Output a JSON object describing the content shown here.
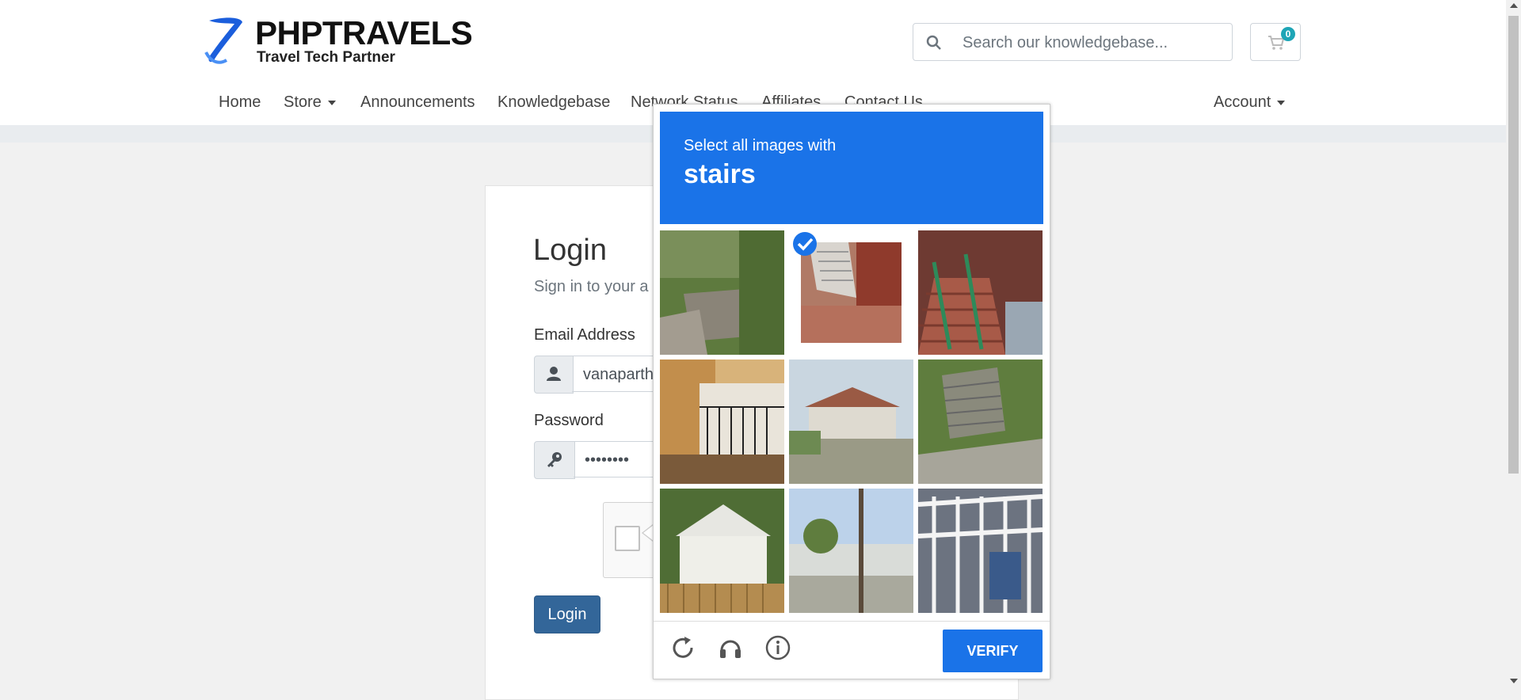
{
  "header": {
    "logo_title": "PHPTRAVELS",
    "logo_subtitle": "Travel Tech Partner",
    "search_placeholder": "Search our knowledgebase...",
    "cart_count": "0"
  },
  "nav": {
    "items": [
      {
        "label": "Home"
      },
      {
        "label": "Store"
      },
      {
        "label": "Announcements"
      },
      {
        "label": "Knowledgebase"
      },
      {
        "label": "Network Status"
      },
      {
        "label": "Affiliates"
      },
      {
        "label": "Contact Us"
      }
    ],
    "account_label": "Account"
  },
  "login": {
    "title": "Login",
    "subtitle": "Sign in to your a",
    "email_label": "Email Address",
    "email_value": "vanaparth",
    "password_label": "Password",
    "password_value": "••••••••",
    "submit_label": "Login"
  },
  "captcha": {
    "instruction": "Select all images with",
    "keyword": "stairs",
    "verify_label": "VERIFY",
    "selected_tile": 2,
    "accent_color": "#1a73e8"
  }
}
